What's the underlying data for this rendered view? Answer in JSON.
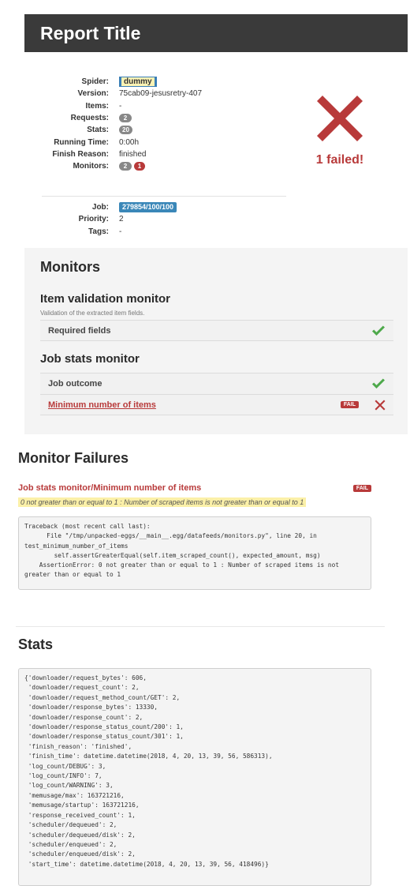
{
  "report": {
    "title": "Report Title"
  },
  "summary": {
    "spider_label": "Spider:",
    "spider_value": "dummy",
    "version_label": "Version:",
    "version_value": "75cab09-jesusretry-407",
    "items_label": "Items:",
    "items_value": "-",
    "requests_label": "Requests:",
    "requests_value": "2",
    "stats_label": "Stats:",
    "stats_value": "20",
    "running_time_label": "Running Time:",
    "running_time_value": "0:00h",
    "finish_reason_label": "Finish Reason:",
    "finish_reason_value": "finished",
    "monitors_label": "Monitors:",
    "monitors_passed": "2",
    "monitors_failed": "1",
    "job_label": "Job:",
    "job_value": "279854/100/100",
    "priority_label": "Priority:",
    "priority_value": "2",
    "tags_label": "Tags:",
    "tags_value": "-",
    "status_text": "1 failed!",
    "status_icon": "x-icon"
  },
  "monitors": {
    "heading": "Monitors",
    "groups": [
      {
        "title": "Item validation monitor",
        "description": "Validation of the extracted item fields.",
        "rows": [
          {
            "name": "Required fields",
            "status": "pass"
          }
        ]
      },
      {
        "title": "Job stats monitor",
        "rows": [
          {
            "name": "Job outcome",
            "status": "pass"
          },
          {
            "name": "Minimum number of items",
            "status": "fail",
            "badge": "FAIL"
          }
        ]
      }
    ]
  },
  "failures": {
    "heading": "Monitor Failures",
    "title": "Job stats monitor/Minimum number of items",
    "badge": "FAIL",
    "message": "0 not greater than or equal to 1 : Number of scraped items is not greater than or equal to 1",
    "traceback": "Traceback (most recent call last):\n      File \"/tmp/unpacked-eggs/__main__.egg/datafeeds/monitors.py\", line 20, in test_minimum_number_of_items\n        self.assertGreaterEqual(self.item_scraped_count(), expected_amount, msg)\n    AssertionError: 0 not greater than or equal to 1 : Number of scraped items is not greater than or equal to 1"
  },
  "stats": {
    "heading": "Stats",
    "dump": "{'downloader/request_bytes': 606,\n 'downloader/request_count': 2,\n 'downloader/request_method_count/GET': 2,\n 'downloader/response_bytes': 13330,\n 'downloader/response_count': 2,\n 'downloader/response_status_count/200': 1,\n 'downloader/response_status_count/301': 1,\n 'finish_reason': 'finished',\n 'finish_time': datetime.datetime(2018, 4, 20, 13, 39, 56, 586313),\n 'log_count/DEBUG': 3,\n 'log_count/INFO': 7,\n 'log_count/WARNING': 3,\n 'memusage/max': 163721216,\n 'memusage/startup': 163721216,\n 'response_received_count': 1,\n 'scheduler/dequeued': 2,\n 'scheduler/dequeued/disk': 2,\n 'scheduler/enqueued': 2,\n 'scheduler/enqueued/disk': 2,\n 'start_time': datetime.datetime(2018, 4, 20, 13, 39, 56, 418496)}"
  },
  "colors": {
    "pass": "#4ea94b",
    "fail": "#b83a3a",
    "header": "#3a3a3a",
    "job_badge": "#3a87b8"
  }
}
